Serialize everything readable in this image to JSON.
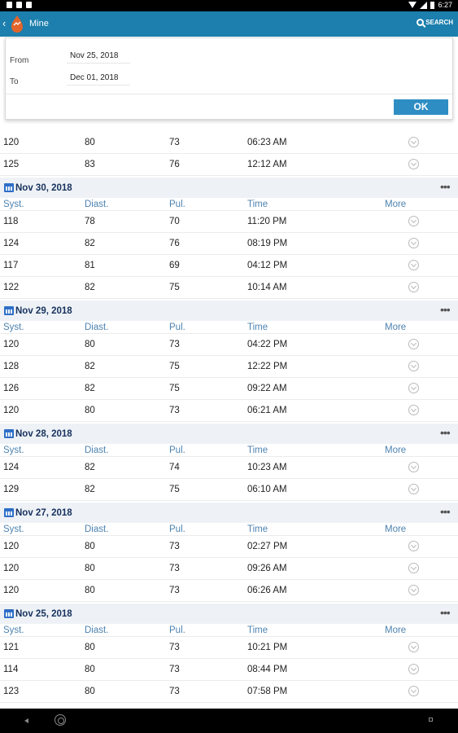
{
  "status_bar": {
    "time": "6:27"
  },
  "app_bar": {
    "title": "Mine",
    "search_label": "SEARCH"
  },
  "filter": {
    "from_label": "From",
    "from_value": "Nov 25, 2018",
    "to_label": "To",
    "to_value": "Dec 01, 2018",
    "ok_label": "OK"
  },
  "columns": {
    "syst": "Syst.",
    "diast": "Diast.",
    "pul": "Pul.",
    "time": "Time",
    "more": "More"
  },
  "partial_rows": [
    {
      "syst": "120",
      "diast": "80",
      "pul": "73",
      "time": "06:23 AM"
    },
    {
      "syst": "125",
      "diast": "83",
      "pul": "76",
      "time": "12:12 AM"
    }
  ],
  "groups": [
    {
      "date": "Nov 30, 2018",
      "rows": [
        {
          "syst": "118",
          "diast": "78",
          "pul": "70",
          "time": "11:20 PM"
        },
        {
          "syst": "124",
          "diast": "82",
          "pul": "76",
          "time": "08:19 PM"
        },
        {
          "syst": "117",
          "diast": "81",
          "pul": "69",
          "time": "04:12 PM"
        },
        {
          "syst": "122",
          "diast": "82",
          "pul": "75",
          "time": "10:14 AM"
        }
      ]
    },
    {
      "date": "Nov 29, 2018",
      "rows": [
        {
          "syst": "120",
          "diast": "80",
          "pul": "73",
          "time": "04:22 PM"
        },
        {
          "syst": "128",
          "diast": "82",
          "pul": "75",
          "time": "12:22 PM"
        },
        {
          "syst": "126",
          "diast": "82",
          "pul": "75",
          "time": "09:22 AM"
        },
        {
          "syst": "120",
          "diast": "80",
          "pul": "73",
          "time": "06:21 AM"
        }
      ]
    },
    {
      "date": "Nov 28, 2018",
      "rows": [
        {
          "syst": "124",
          "diast": "82",
          "pul": "74",
          "time": "10:23 AM"
        },
        {
          "syst": "129",
          "diast": "82",
          "pul": "75",
          "time": "06:10 AM"
        }
      ]
    },
    {
      "date": "Nov 27, 2018",
      "rows": [
        {
          "syst": "120",
          "diast": "80",
          "pul": "73",
          "time": "02:27 PM"
        },
        {
          "syst": "120",
          "diast": "80",
          "pul": "73",
          "time": "09:26 AM"
        },
        {
          "syst": "120",
          "diast": "80",
          "pul": "73",
          "time": "06:26 AM"
        }
      ]
    },
    {
      "date": "Nov 25, 2018",
      "rows": [
        {
          "syst": "121",
          "diast": "80",
          "pul": "73",
          "time": "10:21 PM"
        },
        {
          "syst": "114",
          "diast": "80",
          "pul": "73",
          "time": "08:44 PM"
        },
        {
          "syst": "123",
          "diast": "80",
          "pul": "73",
          "time": "07:58 PM"
        }
      ]
    }
  ],
  "icons": {
    "logo": "hand-drop-logo-icon",
    "search": "search-icon",
    "calendar": "calendar-icon",
    "more": "chevron-down-circle-icon",
    "overflow": "overflow-dots-icon"
  },
  "colors": {
    "app_bar": "#1c7fad",
    "ok_button": "#2e8ec4",
    "column_header": "#4d83b0",
    "date_text": "#17315e"
  }
}
